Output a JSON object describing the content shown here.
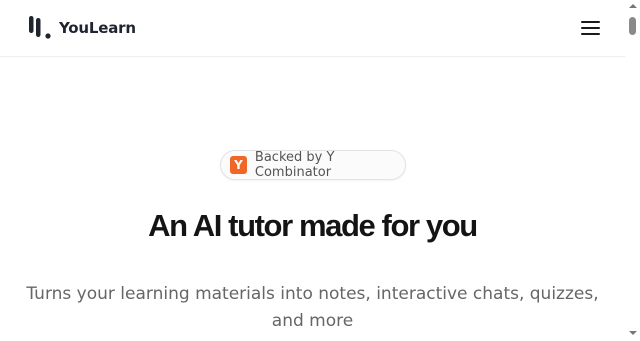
{
  "header": {
    "brand_name": "YouLearn",
    "logo_icon": "youlearn-logo",
    "menu_icon": "hamburger-menu-icon"
  },
  "hero": {
    "badge": {
      "logo_letter": "Y",
      "text": "Backed by Y Combinator",
      "logo_color": "#f26625"
    },
    "headline": "An AI tutor made for you",
    "subheadline": "Turns your learning materials into notes, interactive chats, quizzes, and more"
  },
  "colors": {
    "background": "#ffffff",
    "text_primary": "#141414",
    "text_secondary": "#666666",
    "brand_text": "#1f2430"
  }
}
